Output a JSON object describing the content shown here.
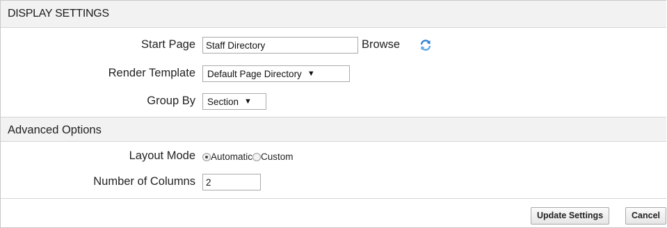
{
  "header": {
    "title": "DISPLAY SETTINGS"
  },
  "fields": {
    "start_page": {
      "label": "Start Page",
      "value": "Staff Directory",
      "browse_label": "Browse",
      "refresh_icon": "refresh-icon"
    },
    "render_template": {
      "label": "Render Template",
      "selected": "Default Page Directory"
    },
    "group_by": {
      "label": "Group By",
      "selected": "Section"
    }
  },
  "advanced": {
    "title": "Advanced Options",
    "layout_mode": {
      "label": "Layout Mode",
      "options": [
        "Automatic",
        "Custom"
      ],
      "selected": "Automatic"
    },
    "columns": {
      "label": "Number of Columns",
      "value": "2"
    }
  },
  "buttons": {
    "update": "Update Settings",
    "cancel": "Cancel"
  },
  "colors": {
    "header_bg": "#f2f2f2",
    "border": "#d4d4d4",
    "refresh_blue": "#2a7fd4"
  }
}
